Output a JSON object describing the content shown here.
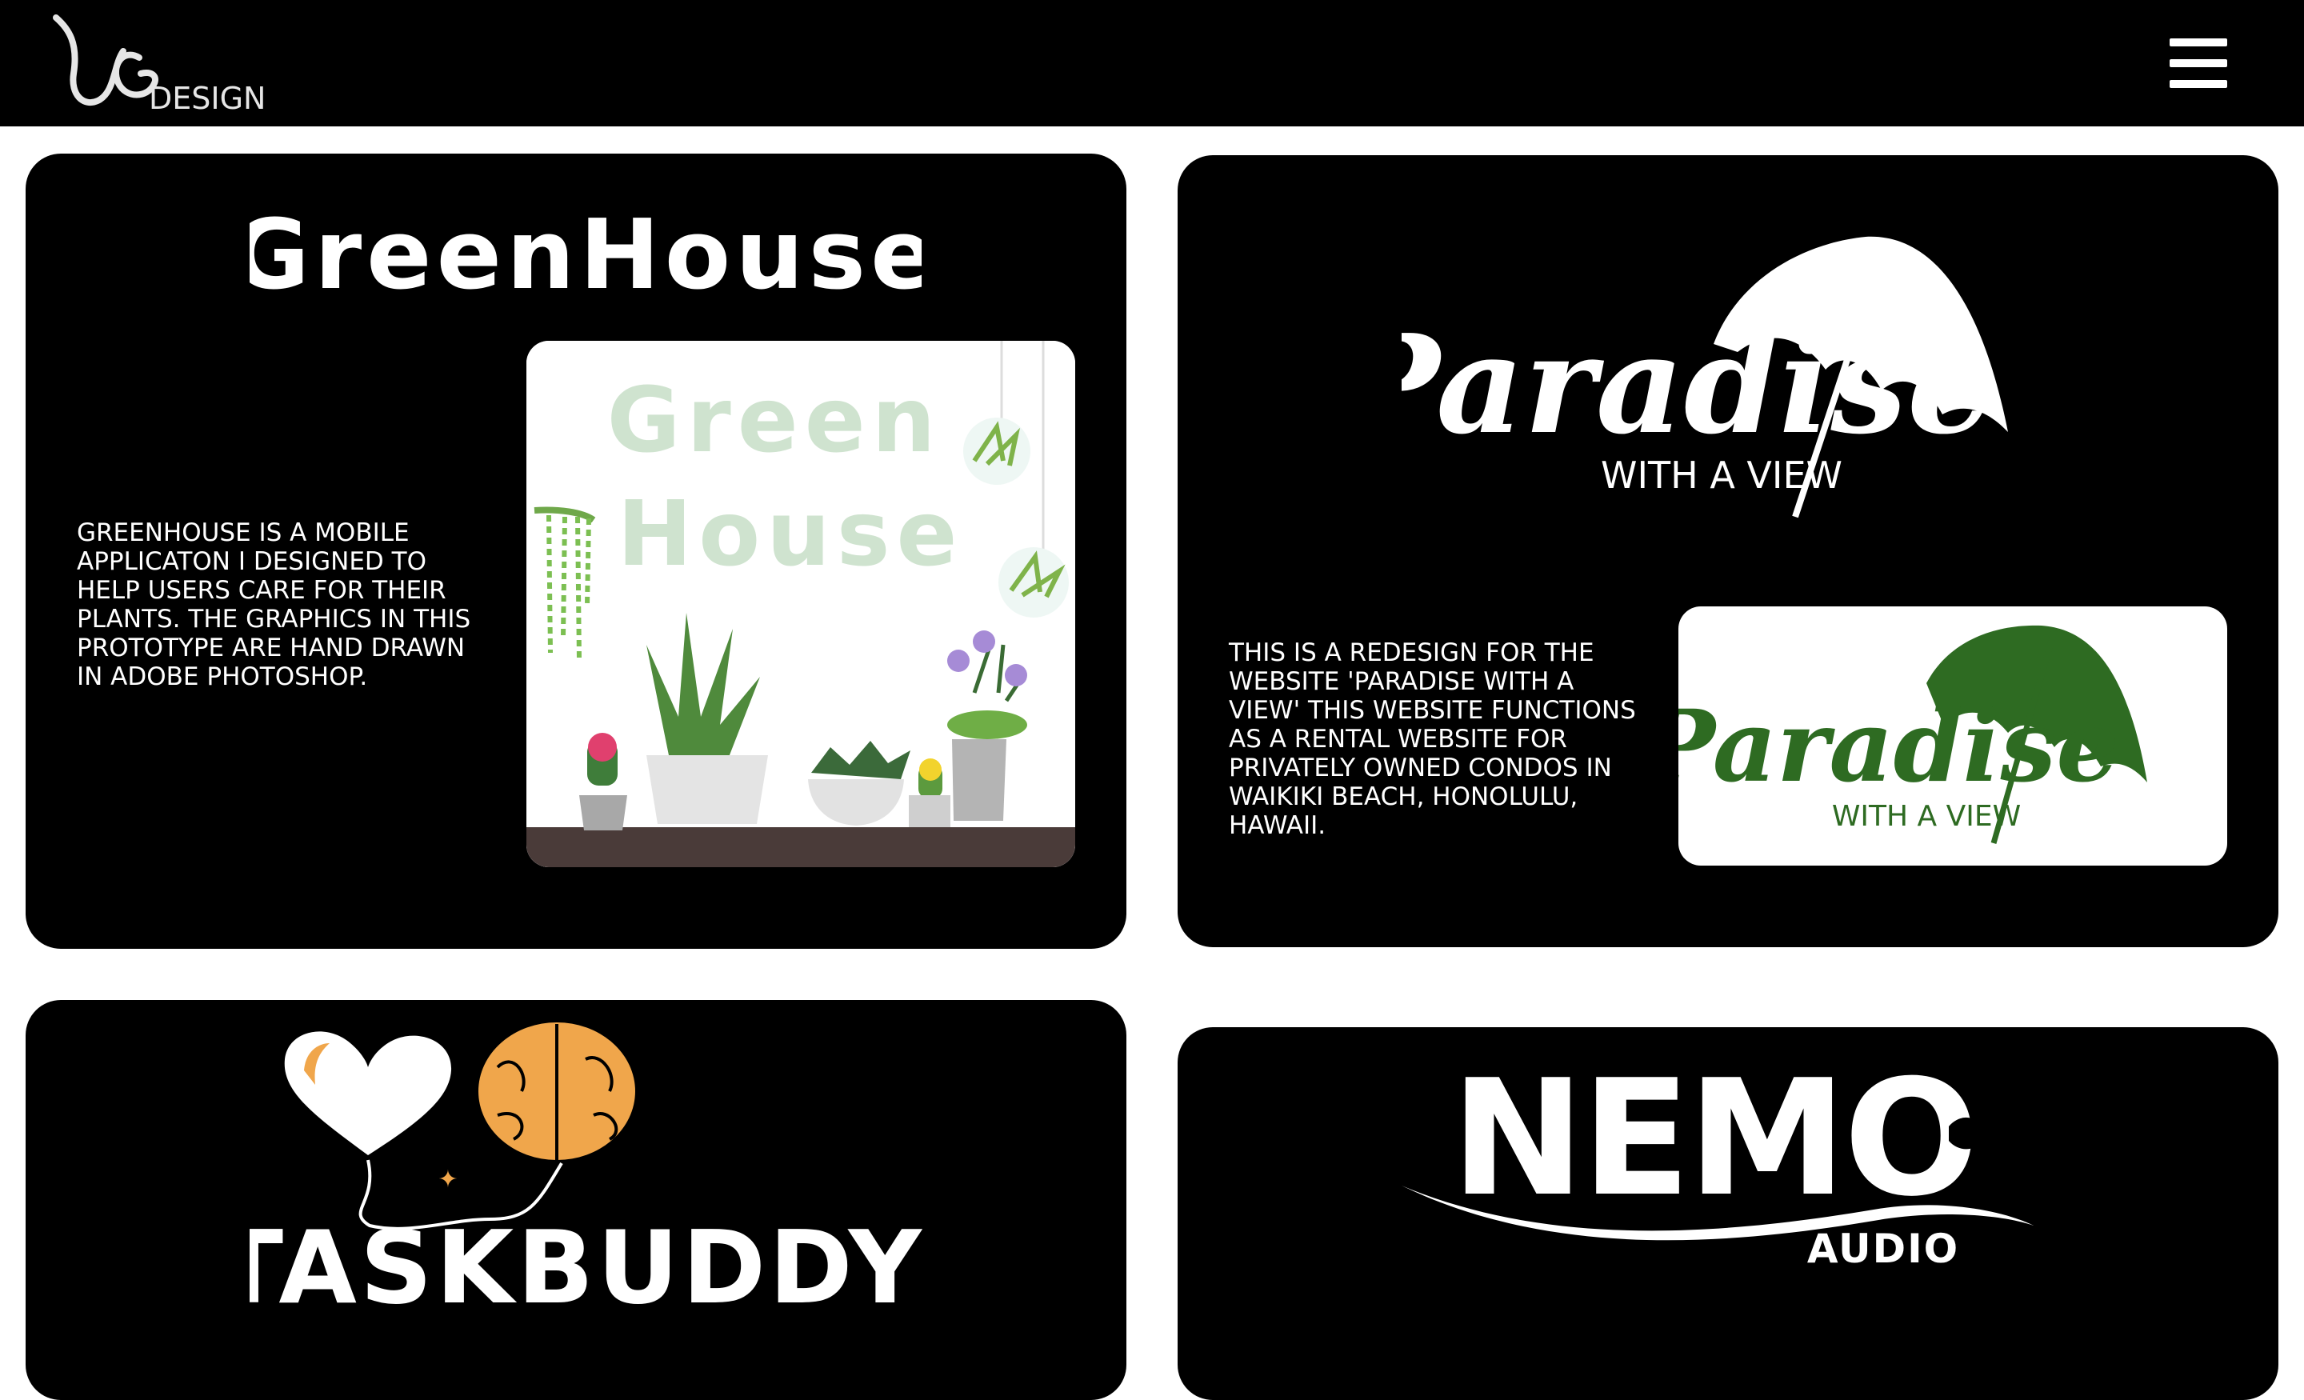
{
  "header": {
    "logo_monogram": "UG",
    "logo_text": "DESIGN",
    "menu_icon": "hamburger-menu-icon"
  },
  "projects": [
    {
      "title": "GreenHouse",
      "description": "GREENHOUSE IS A MOBILE APPLICATON I DESIGNED TO HELP USERS CARE FOR THEIR PLANTS. THE GRAPHICS IN THIS PROTOTYPE ARE HAND DRAWN IN ADOBE PHOTOSHOP.",
      "thumbnail_line1": "Green",
      "thumbnail_line2": "House"
    },
    {
      "title": "Paradise",
      "subtitle": "WITH A VIEW",
      "description": "THIS IS A REDESIGN FOR THE WEBSITE 'PARADISE WITH A VIEW' THIS WEBSITE FUNCTIONS AS A RENTAL WEBSITE FOR PRIVATELY OWNED CONDOS IN WAIKIKI BEACH, HONOLULU, HAWAII.",
      "thumbnail_title": "Paradise",
      "thumbnail_subtitle": "WITH A VIEW"
    },
    {
      "title": "TASKBUDDY"
    },
    {
      "title": "NEMO",
      "subtitle": "AUDIO"
    }
  ],
  "colors": {
    "background": "#ffffff",
    "card": "#000000",
    "paradise_green": "#2e6b22",
    "greenhouse_mint": "#cfe3cf",
    "taskbuddy_orange": "#f0a64b"
  }
}
